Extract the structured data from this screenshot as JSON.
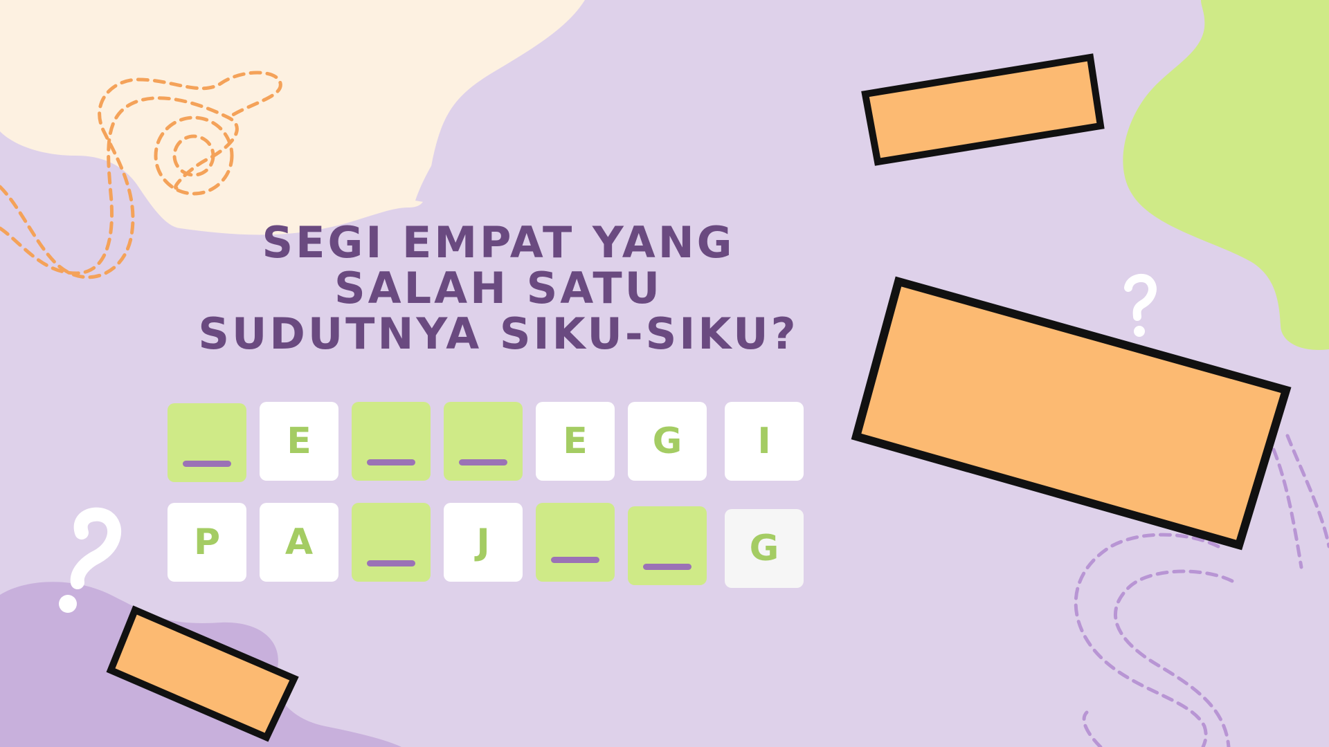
{
  "question": {
    "lines": [
      "SEGI EMPAT YANG",
      "SALAH SATU",
      "SUDUTNYA SIKU-SIKU?"
    ]
  },
  "answer": {
    "row1": [
      {
        "letter": "",
        "revealed": false
      },
      {
        "letter": "E",
        "revealed": true
      },
      {
        "letter": "",
        "revealed": false
      },
      {
        "letter": "",
        "revealed": false
      },
      {
        "letter": "E",
        "revealed": true
      },
      {
        "letter": "G",
        "revealed": true
      },
      {
        "letter": "I",
        "revealed": true
      }
    ],
    "row2": [
      {
        "letter": "P",
        "revealed": true
      },
      {
        "letter": "A",
        "revealed": true
      },
      {
        "letter": "",
        "revealed": false
      },
      {
        "letter": "J",
        "revealed": true
      },
      {
        "letter": "",
        "revealed": false
      },
      {
        "letter": "",
        "revealed": false
      },
      {
        "letter": "G",
        "revealed": true
      }
    ]
  },
  "decorations": {
    "question_mark": "?",
    "colors": {
      "background": "#ded1ea",
      "title": "#6a4a80",
      "tile_letter": "#a4cc63",
      "tile_blank_fill": "#cfea87",
      "blank_line": "#9b72b6",
      "rectangle_fill": "#fcba72",
      "cream_blob": "#fdf1e1",
      "green_blob": "#cfea87",
      "purple_blob": "#c8b0dc",
      "dashed_orange": "#f4a259",
      "dashed_purple": "#b895d4"
    }
  }
}
